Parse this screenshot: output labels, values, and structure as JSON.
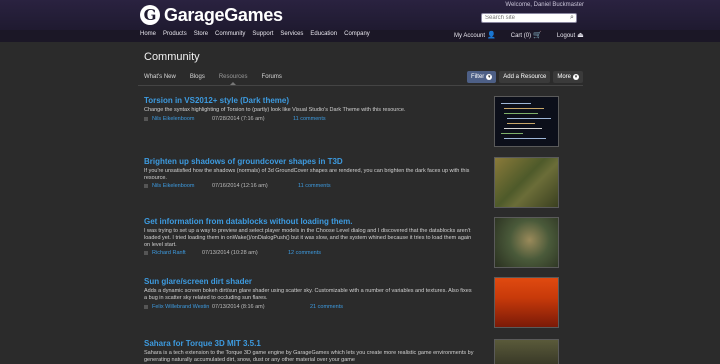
{
  "header": {
    "brand": "GarageGames",
    "welcome": "Welcome, Daniel Buckmaster",
    "search_placeholder": "Search site",
    "nav": [
      "Home",
      "Products",
      "Store",
      "Community",
      "Support",
      "Services",
      "Education",
      "Company"
    ],
    "my_account": "My Account",
    "cart": "Cart",
    "cart_count": "(0)",
    "logout": "Logout"
  },
  "page": {
    "title": "Community",
    "tabs": [
      "What's New",
      "Blogs",
      "Resources",
      "Forums"
    ],
    "active_tab": "Resources",
    "filter_label": "Filter",
    "add_resource_label": "Add a Resource",
    "more_label": "More"
  },
  "resources": [
    {
      "title": "Torsion in VS2012+ style (Dark theme)",
      "description": "Change the syntax highlighting of Torsion to (partly) look like Visual Studio's Dark Theme with this resource.",
      "author": "Nils Eikelenboom",
      "date": "07/28/2014 (7:16 am)",
      "comments": "11 comments"
    },
    {
      "title": "Brighten up shadows of groundcover shapes in T3D",
      "description": "If you're unsatisfied how the shadows (normals) of 3d GroundCover shapes are rendered, you can brighten the dark faces up with this resource.",
      "author": "Nils Eikelenboom",
      "date": "07/16/2014 (12:16 am)",
      "comments": "11 comments"
    },
    {
      "title": "Get information from datablocks without loading them.",
      "description": "I was trying to set up a way to preview and select player models in the Choose Level dialog and I discovered that the datablocks aren't loaded yet. I tried loading them in onWake()/onDialogPush() but it was slow, and the system whined because it tries to load them again on level start.",
      "author": "Richard Ranft",
      "date": "07/13/2014 (10:28 am)",
      "comments": "12 comments"
    },
    {
      "title": "Sun glare/screen dirt shader",
      "description": "Adds a dynamic screen bokeh dirt/sun glare shader using scatter sky. Customizable with a number of variables and textures. Also fixes a bug in scatter sky related to occluding sun flares.",
      "author": "Felix Willebrand Westin",
      "date": "07/13/2014 (8:16 am)",
      "comments": "21 comments"
    },
    {
      "title": "Sahara for Torque 3D MIT 3.5.1",
      "description": "Sahara is a tech extension to the Torque 3D game engine by GarageGames which lets you create more realistic game environments by generating naturally accumulated dirt, snow, dust or any other material over your game",
      "author": "",
      "date": "",
      "comments": ""
    }
  ]
}
